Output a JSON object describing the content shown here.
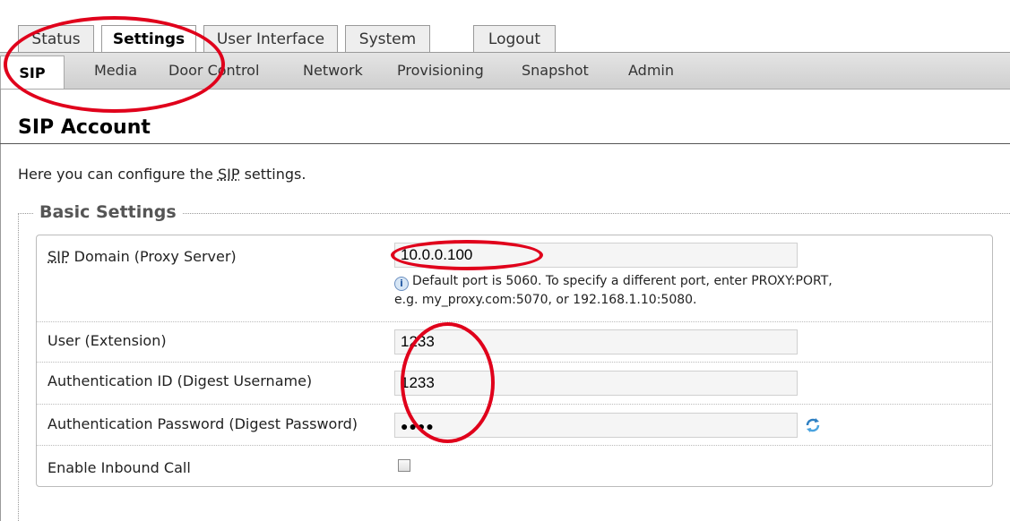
{
  "top_tabs": [
    {
      "label": "Status"
    },
    {
      "label": "Settings"
    },
    {
      "label": "User Interface"
    },
    {
      "label": "System"
    },
    {
      "label": "Logout"
    }
  ],
  "sub_tabs": [
    {
      "label": "SIP"
    },
    {
      "label": "Media"
    },
    {
      "label": "Door Control"
    },
    {
      "label": "Network"
    },
    {
      "label": "Provisioning"
    },
    {
      "label": "Snapshot"
    },
    {
      "label": "Admin"
    }
  ],
  "page": {
    "title": "SIP Account",
    "intro_prefix": "Here you can configure the ",
    "intro_abbr": "SIP",
    "intro_suffix": " settings."
  },
  "basic_settings": {
    "legend": "Basic Settings",
    "sip_domain": {
      "label_abbr": "SIP",
      "label_rest": " Domain (Proxy Server)",
      "value": "10.0.0.100",
      "hint_line1": "Default port is 5060. To specify a different port, enter PROXY:PORT,",
      "hint_line2": "e.g. my_proxy.com:5070, or 192.168.1.10:5080."
    },
    "user": {
      "label": "User (Extension)",
      "value": "1233"
    },
    "auth_id": {
      "label": "Authentication ID (Digest Username)",
      "value": "1233"
    },
    "auth_password": {
      "label": "Authentication Password (Digest Password)",
      "value": "●●●●"
    },
    "inbound_call": {
      "label": "Enable Inbound Call",
      "checked": false
    }
  },
  "colors": {
    "annotation": "#e0001b"
  },
  "icons": {
    "info": "info-icon",
    "refresh": "refresh-icon"
  }
}
